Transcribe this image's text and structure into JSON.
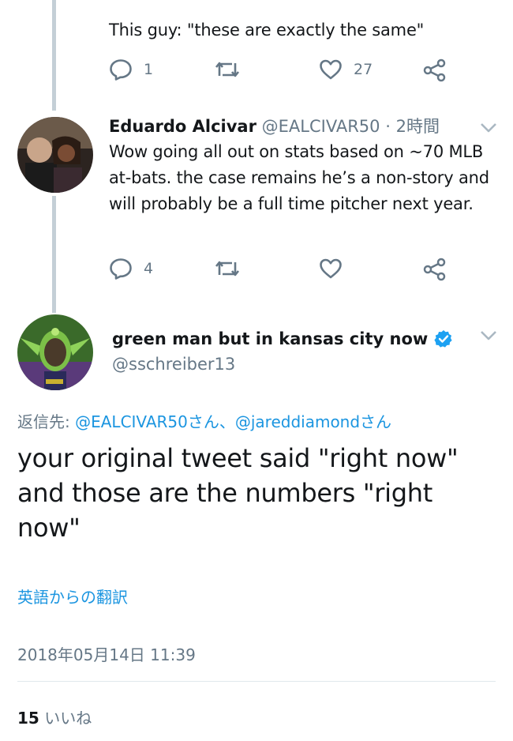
{
  "prev_tweet": {
    "text": "This guy: \"these are exactly the same\"",
    "reply_count": "1",
    "retweet_count": "",
    "like_count": "27"
  },
  "reply_tweet": {
    "display_name": "Eduardo Alcivar",
    "handle": "@EALCIVAR50",
    "separator": "·",
    "time_ago": "2時間",
    "text": "Wow going all out on stats based on ~70 MLB at-bats. the case remains he’s a non-story and will probably be a full time pitcher next year.",
    "reply_count": "4",
    "retweet_count": "",
    "like_count": ""
  },
  "focused_tweet": {
    "display_name": "green man but in kansas city now",
    "handle": "@sschreiber13",
    "reply_to_label": "返信先:",
    "reply_to_users": "@EALCIVAR50さん、@jareddiamondさん",
    "text": "your original tweet said \"right now\" and those are the numbers \"right now\"",
    "translate_link": "英語からの翻訳",
    "timestamp": "2018年05月14日 11:39",
    "likes_count": "15",
    "likes_label": "いいね"
  },
  "icons": {
    "reply": "reply-icon",
    "retweet": "retweet-icon",
    "like": "heart-icon",
    "share": "share-icon",
    "menu": "chevron-down-icon",
    "verified": "verified-badge-icon"
  },
  "colors": {
    "text": "#14171a",
    "secondary": "#657786",
    "link": "#1b95e0",
    "thread_line": "#c4cfd6",
    "verified": "#1da1f2"
  }
}
